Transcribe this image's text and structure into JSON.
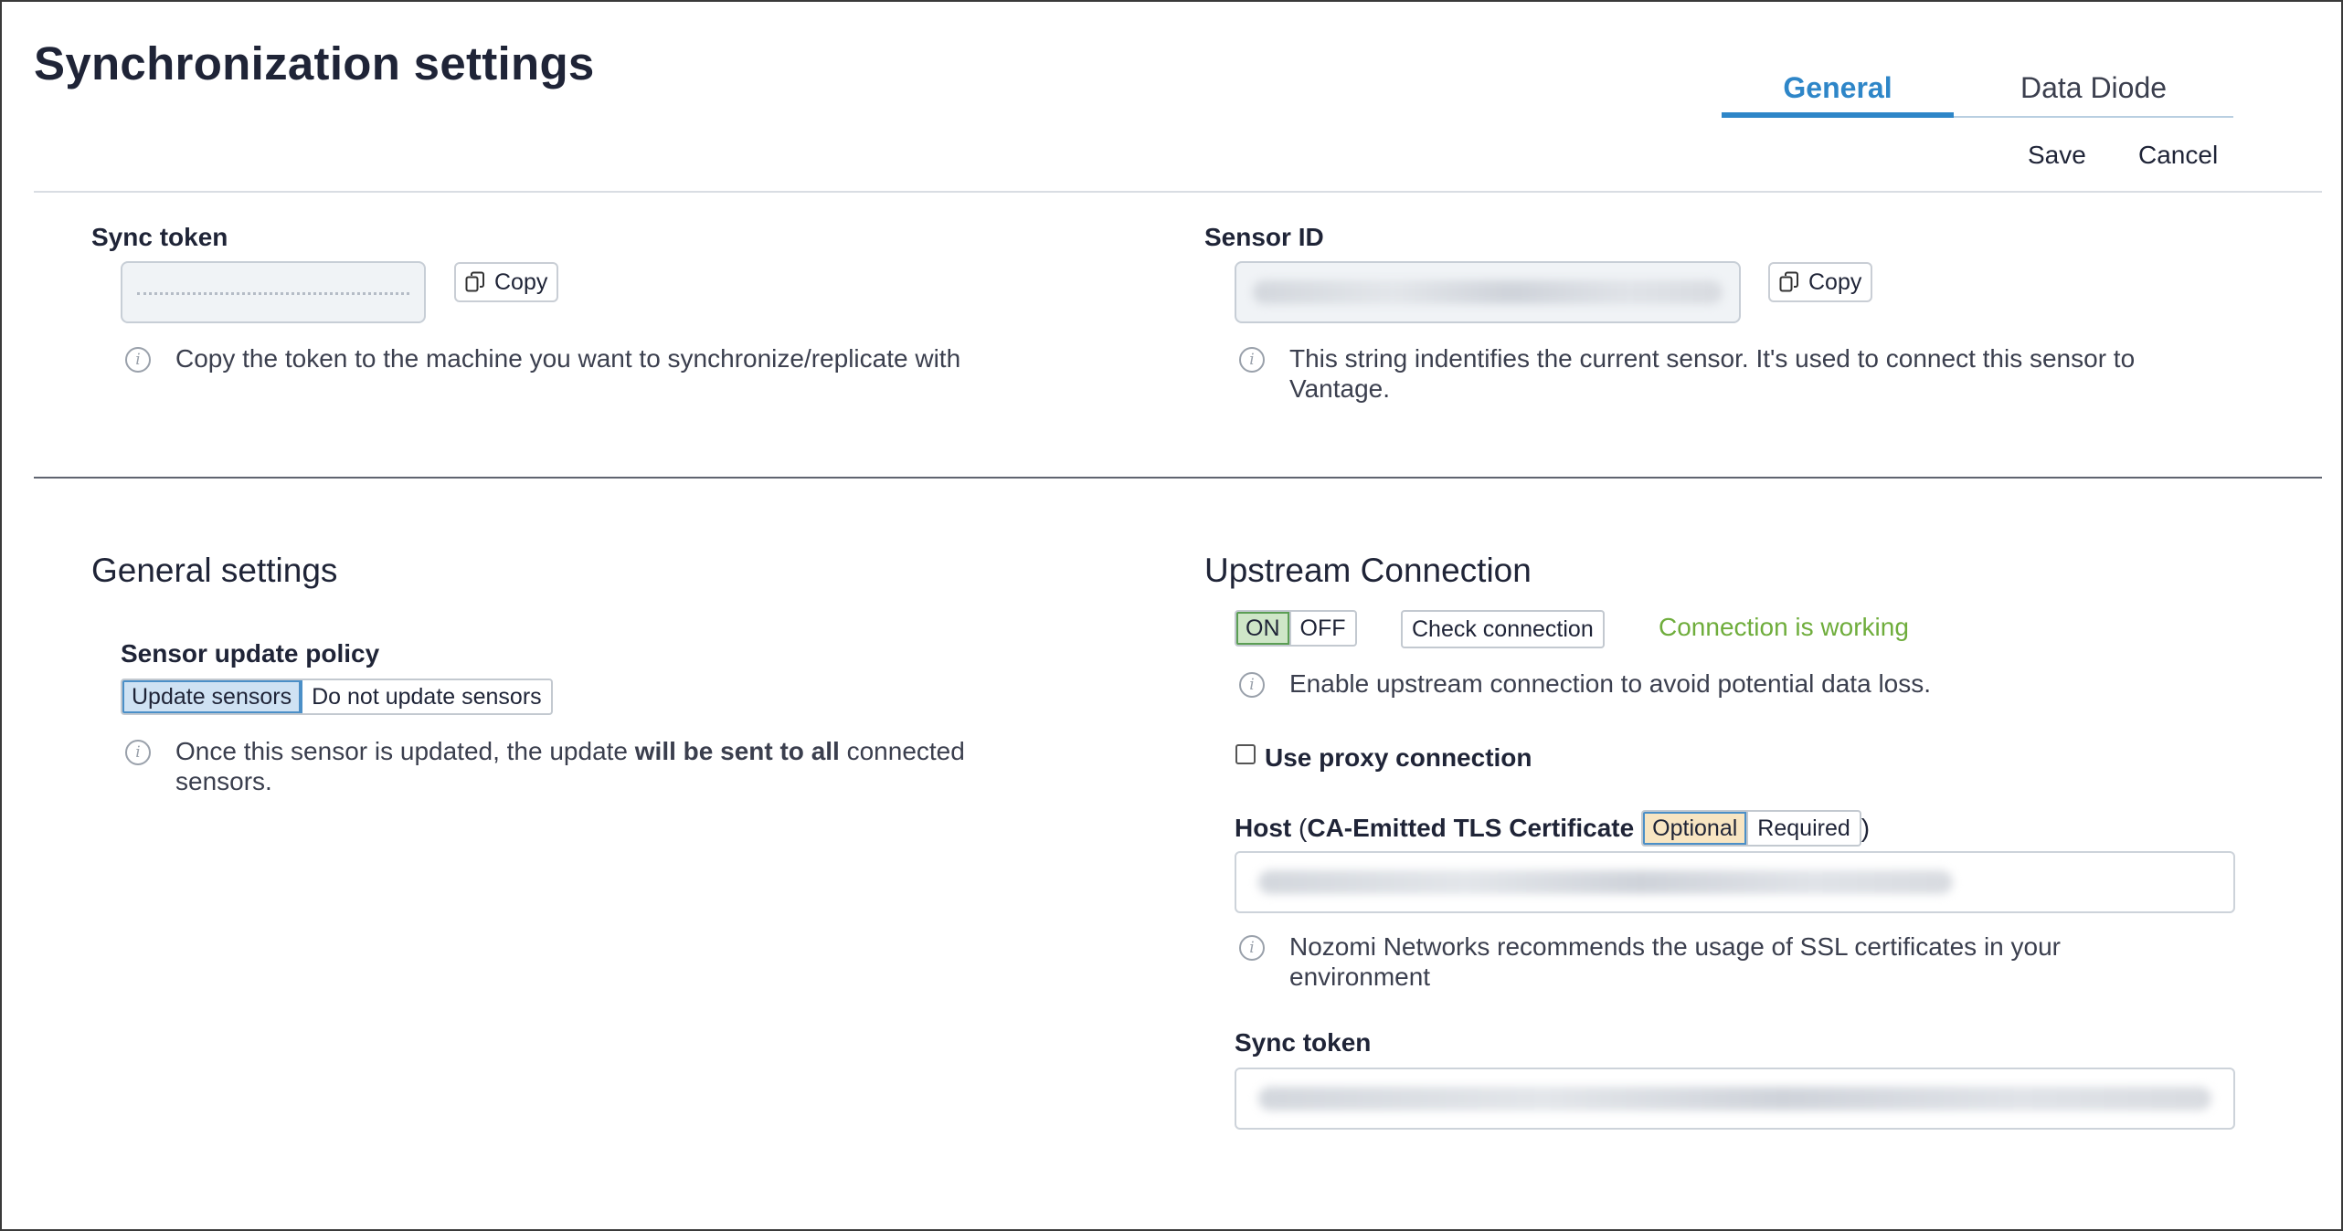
{
  "page_title": "Synchronization settings",
  "tabs": [
    {
      "label": "General",
      "active": true
    },
    {
      "label": "Data Diode",
      "active": false
    }
  ],
  "actions": {
    "save": "Save",
    "cancel": "Cancel"
  },
  "sync_token": {
    "label": "Sync token",
    "copy_label": "Copy",
    "help": "Copy the token to the machine you want to synchronize/replicate with"
  },
  "sensor_id": {
    "label": "Sensor ID",
    "copy_label": "Copy",
    "help_line1": "This string indentifies the current sensor. It's used to connect this sensor to",
    "help_line2": "Vantage."
  },
  "general_settings": {
    "title": "General settings",
    "policy_label": "Sensor update policy",
    "options": [
      "Update sensors",
      "Do not update sensors"
    ],
    "selected": "Update sensors",
    "help_part1": "Once this sensor is updated, the update ",
    "help_bold": "will be sent to all",
    "help_part2": " connected",
    "help_line2": "sensors."
  },
  "upstream": {
    "title": "Upstream Connection",
    "toggle_on": "ON",
    "toggle_off": "OFF",
    "toggle_state": "ON",
    "check_button": "Check connection",
    "status": "Connection is working",
    "help": "Enable upstream connection to avoid potential data loss.",
    "proxy_label": "Use proxy connection",
    "proxy_checked": false,
    "host_label": "Host",
    "host_paren_open": " (",
    "cert_label": "CA-Emitted TLS Certificate",
    "cert_options": [
      "Optional",
      "Required"
    ],
    "cert_selected": "Optional",
    "host_paren_close": ")",
    "host_help_line1": "Nozomi Networks recommends the usage of SSL certificates in your",
    "host_help_line2": "environment",
    "token_label": "Sync token"
  },
  "colors": {
    "accent": "#2e86c8",
    "status_ok": "#6fad3c",
    "selected_blue": "#cfe2f3",
    "selected_green": "#cfe6c8",
    "selected_orange": "#f8e5c2"
  },
  "icons": {
    "copy": "copy-icon",
    "info": "info-icon"
  }
}
